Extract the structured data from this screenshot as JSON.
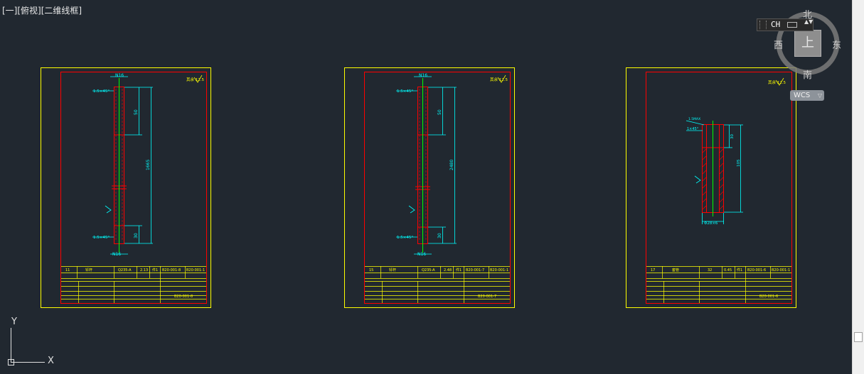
{
  "viewport": {
    "label": "[一][俯视][二维线框]"
  },
  "ime": {
    "text": "CH",
    "arrows": "▲▼"
  },
  "viewcube": {
    "north": "北",
    "south": "南",
    "east": "东",
    "west": "西",
    "top": "上",
    "wcs": "WCS",
    "wcs_arrow": "▽"
  },
  "ucs": {
    "x_label": "X",
    "y_label": "Y"
  },
  "sheets": [
    {
      "n_top": "N16",
      "n_bottom": "N16",
      "chamfer_top": "1.5×45°",
      "chamfer_bottom": "1.5×45°",
      "dim_top": "50",
      "dim_bottom": "30",
      "dim_total": "1665",
      "roughness": "其余 12.5",
      "title_cells": [
        "11",
        "钎杆",
        "Q235-A",
        "2.13",
        "件1",
        "B20-001-8",
        "B20-001-1"
      ],
      "drawing_no": "B20-001-8"
    },
    {
      "n_top": "N16",
      "n_bottom": "N16",
      "chamfer_top": "1.5×45°",
      "chamfer_bottom": "1.5×45°",
      "dim_top": "50",
      "dim_bottom": "30",
      "dim_total": "2480",
      "roughness": "其余 12.5",
      "title_cells": [
        "15",
        "钎杆",
        "Q235-A",
        "2.48",
        "件1",
        "B20-001-7",
        "B20-001-1"
      ],
      "drawing_no": "B20-001-7"
    },
    {
      "chamfer_top": "1×45°",
      "top_label": "1.5MAX",
      "dim_top": "30",
      "dim_total": "105",
      "dim_width": "Φ28×6",
      "roughness": "其余 12.5",
      "title_cells": [
        "17",
        "套管",
        "32",
        "0.45",
        "件1",
        "B20-001-6",
        "B20-001-1"
      ],
      "drawing_no": "B20-001-6"
    }
  ],
  "colors": {
    "background": "#212830",
    "frame": "#ffff00",
    "outline": "#ff0000",
    "dimension": "#00ffff",
    "centerline": "#00ff00",
    "text": "#ffffff"
  }
}
